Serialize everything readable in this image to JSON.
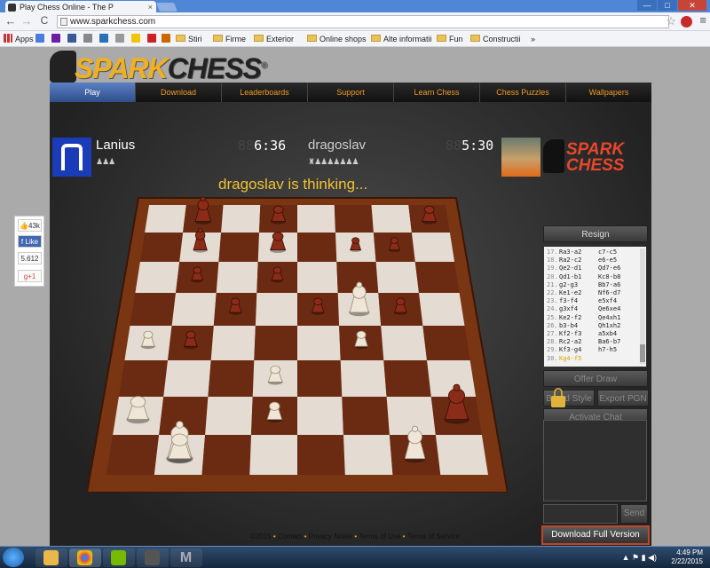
{
  "browser": {
    "tab_title": "Play Chess Online - The P",
    "tab_close": "×",
    "url": "www.sparkchess.com",
    "nav_back": "←",
    "nav_forward": "→",
    "nav_reload": "C",
    "star": "☆",
    "menu": "≡",
    "win_min": "—",
    "win_max": "□",
    "win_close": "✕"
  },
  "bookmarks": {
    "items": [
      "Apps",
      "Stiri",
      "Firme",
      "Exterior",
      "Online shops",
      "Alte informatii",
      "Fun",
      "Constructii",
      "»"
    ]
  },
  "site": {
    "logo_text_1": "SPARK",
    "logo_text_2": "CHESS",
    "logo_mark": "®",
    "nav": [
      "Play",
      "Download",
      "Leaderboards",
      "Support",
      "Learn Chess",
      "Chess Puzzles",
      "Wallpapers"
    ]
  },
  "game": {
    "player1": {
      "name": "Lanius",
      "clock": "6:36",
      "captured": "♟♟♟"
    },
    "player2": {
      "name": "dragoslav",
      "clock": "5:30",
      "captured": "♜♟♟♟♟♟♟♟"
    },
    "clock_prefix": "88",
    "status": "dragoslav is thinking...",
    "brand_1": "SPARK",
    "brand_2": "CHESS",
    "buttons": {
      "resign": "Resign",
      "offer_draw": "Offer Draw",
      "board_style": "Board Style",
      "export_pgn": "Export PGN",
      "activate_chat": "Activate Chat",
      "send": "Send",
      "download_full": "Download Full Version"
    },
    "moves": [
      {
        "n": "17.",
        "w": "Ra3-a2",
        "b": "c7-c5"
      },
      {
        "n": "18.",
        "w": "Ra2-c2",
        "b": "e6-e5"
      },
      {
        "n": "19.",
        "w": "Qe2-d1",
        "b": "Qd7-e6"
      },
      {
        "n": "20.",
        "w": "Qd1-b1",
        "b": "Kc8-b8"
      },
      {
        "n": "21.",
        "w": "g2-g3",
        "b": "Bb7-a6"
      },
      {
        "n": "22.",
        "w": "Ke1-e2",
        "b": "Nf6-d7"
      },
      {
        "n": "23.",
        "w": "f3-f4",
        "b": "e5xf4"
      },
      {
        "n": "24.",
        "w": "g3xf4",
        "b": "Qe6xe4"
      },
      {
        "n": "25.",
        "w": "Ke2-f2",
        "b": "Qe4xh1"
      },
      {
        "n": "26.",
        "w": "b3-b4",
        "b": "Qh1xh2"
      },
      {
        "n": "27.",
        "w": "Kf2-f3",
        "b": "a5xb4"
      },
      {
        "n": "28.",
        "w": "Rc2-a2",
        "b": "Ba6-b7"
      },
      {
        "n": "29.",
        "w": "Kf3-g4",
        "b": "h7-h5"
      },
      {
        "n": "30.",
        "w": "Kg4-f5",
        "b": ""
      }
    ]
  },
  "footer": {
    "copyright": "©2015",
    "sep": "•",
    "links": [
      "Contact",
      "Privacy Notes",
      "Terms of Use",
      "Terms of Service"
    ]
  },
  "social": {
    "likes": "43k",
    "like_label": "Like",
    "count": "5.612",
    "gplus": "+1"
  },
  "taskbar": {
    "time": "4:49 PM",
    "date": "2/22/2015",
    "app_letter": "M",
    "tray_icons": "▲ ⚑ ▮ ◀)"
  },
  "colors": {
    "accent": "#f09a1e",
    "nav_active": "#4a6fb8",
    "status_text": "#f1c232",
    "highlight_border": "#c0452a",
    "dark_square": "#6b2a12",
    "light_square": "#e4dcd2"
  },
  "board": {
    "white_pieces": [
      {
        "sq": "f5",
        "p": "K"
      },
      {
        "sq": "a4",
        "p": "P"
      },
      {
        "sq": "f4",
        "p": "P"
      },
      {
        "sq": "d3",
        "p": "P"
      },
      {
        "sq": "d2",
        "p": "P"
      },
      {
        "sq": "a2",
        "p": "R"
      },
      {
        "sq": "b1",
        "p": "Q"
      },
      {
        "sq": "b1b",
        "p": "R"
      },
      {
        "sq": "g1",
        "p": "B"
      }
    ],
    "black_pieces": [
      {
        "sq": "b8",
        "p": "K"
      },
      {
        "sq": "b7",
        "p": "B"
      },
      {
        "sq": "d7",
        "p": "N"
      },
      {
        "sq": "d8",
        "p": "R"
      },
      {
        "sq": "f7",
        "p": "P"
      },
      {
        "sq": "h8",
        "p": "R"
      },
      {
        "sq": "g7",
        "p": "P"
      },
      {
        "sq": "b6",
        "p": "P"
      },
      {
        "sq": "c5",
        "p": "P"
      },
      {
        "sq": "g5",
        "p": "P"
      },
      {
        "sq": "e5",
        "p": "P"
      },
      {
        "sq": "d6",
        "p": "P"
      },
      {
        "sq": "b4",
        "p": "P"
      },
      {
        "sq": "h2",
        "p": "Q"
      }
    ]
  }
}
